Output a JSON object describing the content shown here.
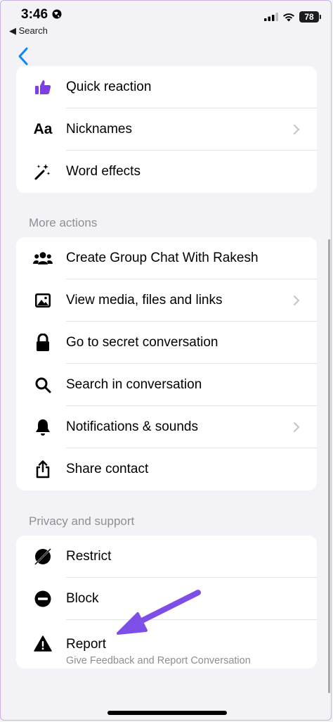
{
  "status": {
    "time": "3:46",
    "back_label": "Search",
    "battery": "78"
  },
  "colors": {
    "accent": "#0a84ff",
    "purple": "#7b3fe4",
    "annotation": "#7d4fe8"
  },
  "customize": {
    "items": [
      {
        "label": "Quick reaction",
        "icon": "thumbs-up-icon"
      },
      {
        "label": "Nicknames",
        "icon": "aa-text-icon",
        "chevron": true
      },
      {
        "label": "Word effects",
        "icon": "magic-wand-icon"
      }
    ]
  },
  "more_actions": {
    "title": "More actions",
    "items": [
      {
        "label": "Create Group Chat With Rakesh",
        "icon": "group-icon"
      },
      {
        "label": "View media, files and links",
        "icon": "image-icon",
        "chevron": true
      },
      {
        "label": "Go to secret conversation",
        "icon": "lock-icon"
      },
      {
        "label": "Search in conversation",
        "icon": "search-icon"
      },
      {
        "label": "Notifications & sounds",
        "icon": "bell-icon",
        "chevron": true
      },
      {
        "label": "Share contact",
        "icon": "share-icon"
      }
    ]
  },
  "privacy": {
    "title": "Privacy and support",
    "items": [
      {
        "label": "Restrict",
        "icon": "restrict-icon"
      },
      {
        "label": "Block",
        "icon": "block-icon"
      },
      {
        "label": "Report",
        "subtitle": "Give Feedback and Report Conversation",
        "icon": "warning-icon"
      }
    ]
  }
}
